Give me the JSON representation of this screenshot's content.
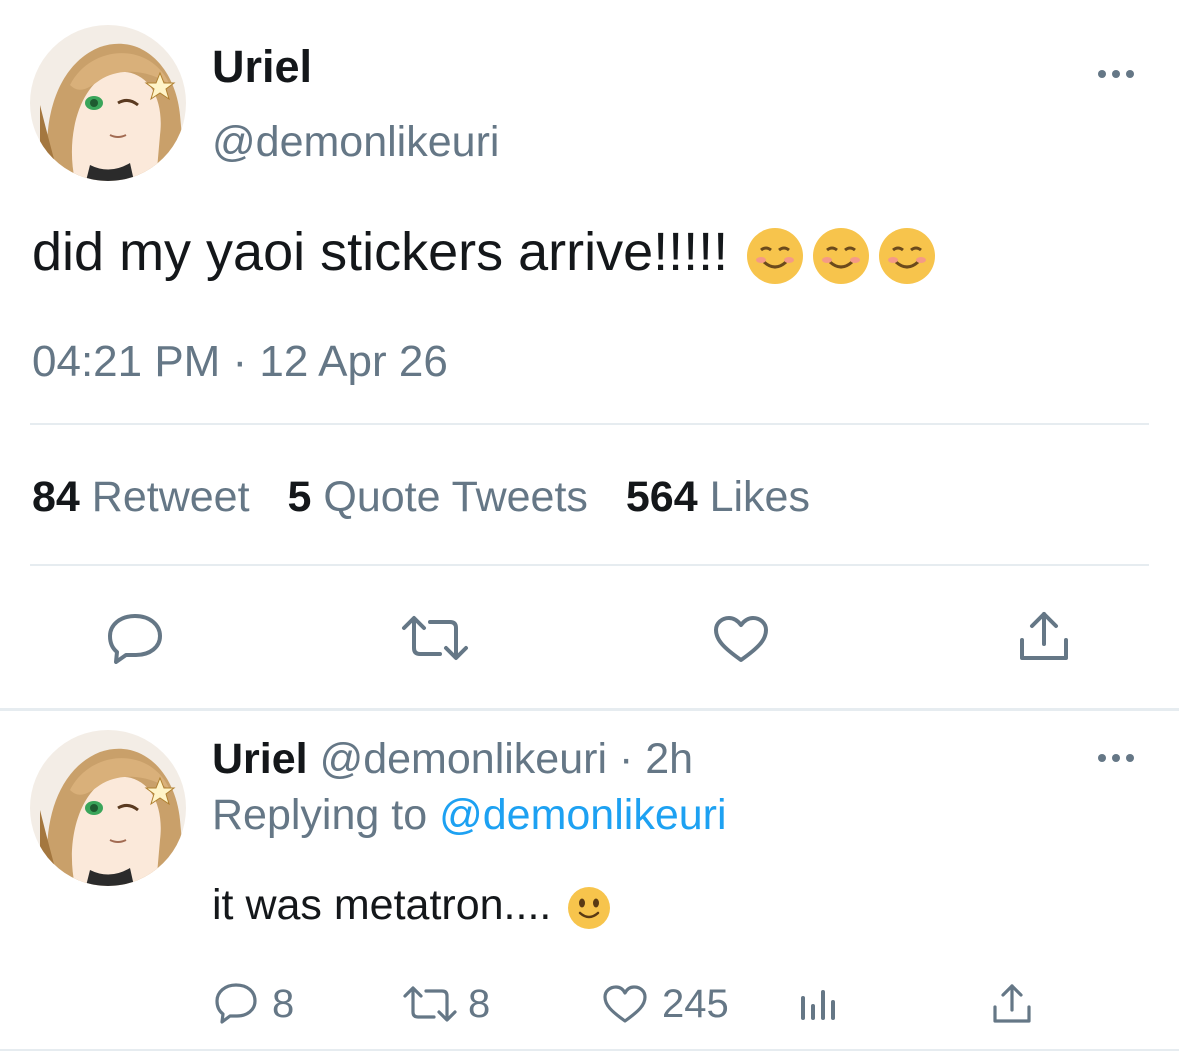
{
  "main_tweet": {
    "author_name": "Uriel",
    "author_handle": "@demonlikeuri",
    "text": "did my yaoi stickers arrive!!!!! ",
    "emoji": [
      "smiling-face",
      "smiling-face",
      "smiling-face"
    ],
    "timestamp": "04:21 PM · 12 Apr 26",
    "stats": {
      "retweets_count": "84",
      "retweets_label": "Retweet",
      "quotes_count": "5",
      "quotes_label": "Quote Tweets",
      "likes_count": "564",
      "likes_label": "Likes"
    },
    "actions": [
      "reply-icon",
      "retweet-icon",
      "like-icon",
      "share-icon"
    ]
  },
  "reply": {
    "author_name": "Uriel",
    "author_handle": "@demonlikeuri",
    "time": "· 2h",
    "replying_prefix": "Replying to",
    "replying_handle": "@demonlikeuri",
    "text": "it was metatron.... ",
    "emoji": "slightly-smiling-face",
    "reply_count": "8",
    "retweet_count": "8",
    "like_count": "245"
  },
  "colors": {
    "text": "#14171a",
    "muted": "#657786",
    "link": "#1da1f2",
    "divider": "#e6ecf0",
    "emoji_yellow": "#f7c44c"
  }
}
